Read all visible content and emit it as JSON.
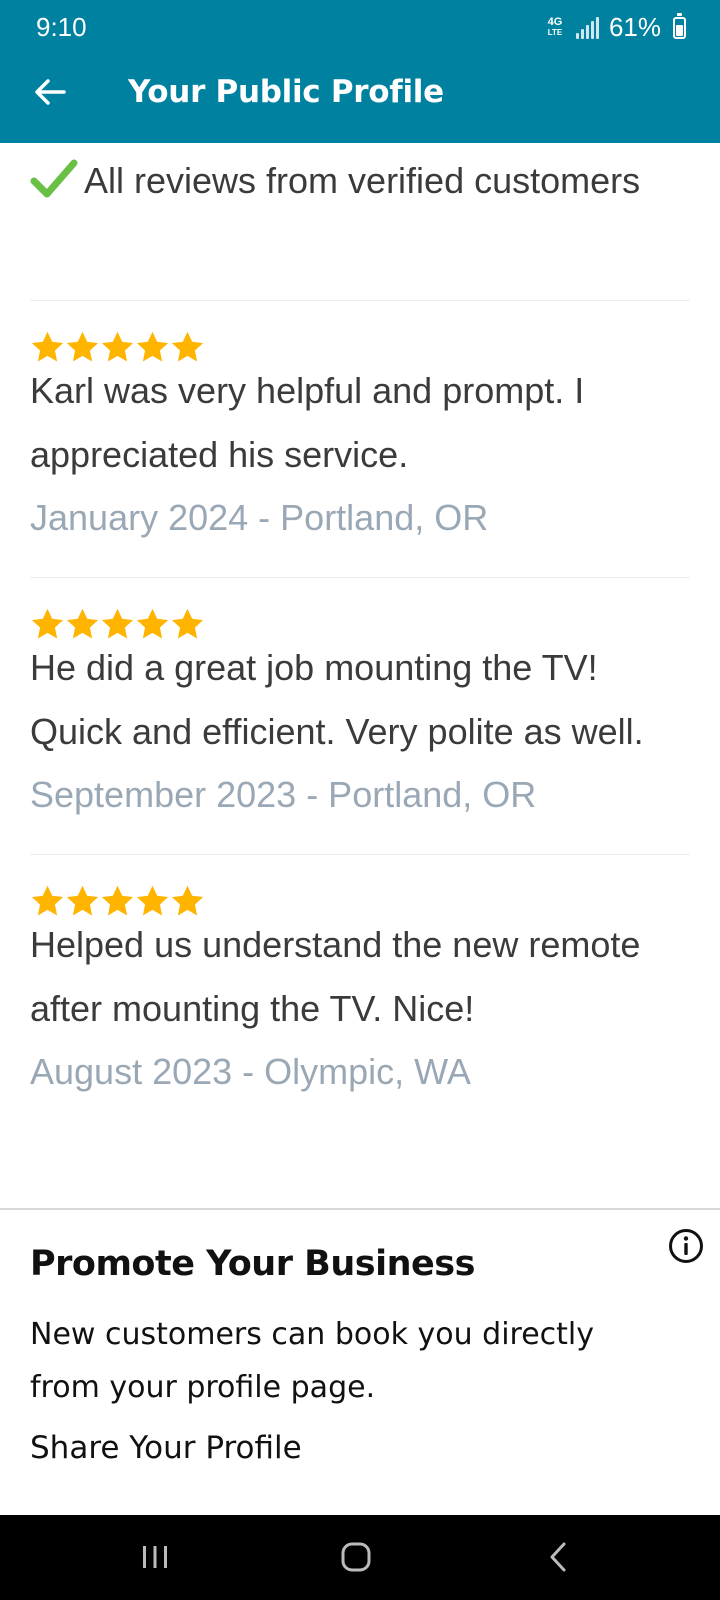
{
  "status_bar": {
    "time": "9:10",
    "network": "4G LTE",
    "battery": "61%"
  },
  "toolbar": {
    "back_icon": "arrow-left-icon",
    "title": "Your Public Profile"
  },
  "verified": {
    "icon": "check-icon",
    "text": "All reviews from verified customers"
  },
  "reviews": [
    {
      "rating": 5,
      "text": "Karl was very helpful and prompt. I appreciated his service.",
      "meta": "January 2024 - Portland, OR"
    },
    {
      "rating": 5,
      "text": "He did a great job mounting the TV! Quick and efficient. Very polite as well.",
      "meta": "September 2023 - Portland, OR"
    },
    {
      "rating": 5,
      "text": "Helped us understand the new remote after mounting the TV. Nice!",
      "meta": "August 2023 - Olympic, WA"
    }
  ],
  "promo": {
    "title": "Promote Your Business",
    "body": "New customers can book you directly from your profile page.",
    "share_label": "Share Your Profile",
    "info_icon": "info-icon"
  },
  "navbar": {
    "recents_icon": "recents-icon",
    "home_icon": "home-icon",
    "back_icon": "back-chevron-icon"
  },
  "colors": {
    "header": "#00819f",
    "star": "#ffb400",
    "check": "#6abf45",
    "meta_text": "#9aa8b5"
  }
}
